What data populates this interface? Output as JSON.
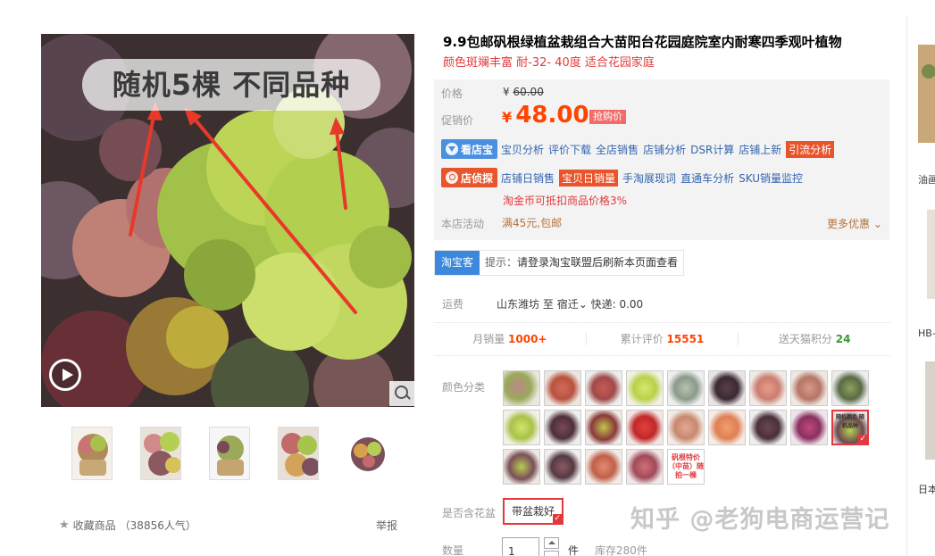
{
  "gallery": {
    "overlay_text": "随机5棵 不同品种",
    "favorite_label": "收藏商品",
    "favorite_count": "（38856人气）",
    "report_label": "举报"
  },
  "product": {
    "title": "9.9包邮矾根绿植盆栽组合大苗阳台花园庭院室内耐寒四季观叶植物",
    "subtitle": "颜色斑斓丰富 耐-32- 40度 适合花园家庭"
  },
  "price": {
    "label_price": "价格",
    "original_currency": "¥",
    "original": "60.00",
    "label_promo": "促销价",
    "promo_currency": "¥",
    "promo": "48.00",
    "promo_badge": "抢购价"
  },
  "tools": {
    "row1_button": "看店宝",
    "row1_links": [
      "宝贝分析",
      "评价下载",
      "全店销售",
      "店铺分析",
      "DSR计算",
      "店铺上新"
    ],
    "row1_highlight": "引流分析",
    "row2_button": "店侦探",
    "row2_link1": "店铺日销售",
    "row2_highlight": "宝贝日销量",
    "row2_links": [
      "手淘展现词",
      "直通车分析",
      "SKU销量监控"
    ],
    "coin_note": "淘金币可抵扣商品价格3%"
  },
  "shop_activity": {
    "label": "本店活动",
    "value": "满45元,包邮",
    "more": "更多优惠"
  },
  "taobaoke": {
    "tag": "淘宝客",
    "tip_prefix": "提示：",
    "tip": "请登录淘宝联盟后刷新本页面查看"
  },
  "shipping": {
    "label": "运费",
    "from": "山东潍坊",
    "to_word": "至",
    "to": "宿迁",
    "method": "快递: 0.00"
  },
  "stats": [
    {
      "label": "月销量",
      "value": "1000+"
    },
    {
      "label": "累计评价",
      "value": "15551"
    },
    {
      "label": "送天猫积分",
      "value": "24"
    }
  ],
  "color_category": {
    "label": "颜色分类",
    "swatch_text": "矾根特价（中苗）随拍一棵",
    "selected_swatch_text": "随机颜色 随机品种"
  },
  "pot": {
    "label": "是否含花盆",
    "option": "带盆栽好"
  },
  "quantity": {
    "label": "数量",
    "value": "1",
    "unit": "件",
    "stock": "库存280件"
  },
  "watermark": "知乎 @老狗电商运营记",
  "side": {
    "label1": "油画",
    "label2": "HB-",
    "label3": "日本"
  },
  "colors": {
    "accent_red": "#f40",
    "link_blue": "#3465b0",
    "tbk_blue": "#3c88dc",
    "tool_orange": "#e8542b"
  }
}
